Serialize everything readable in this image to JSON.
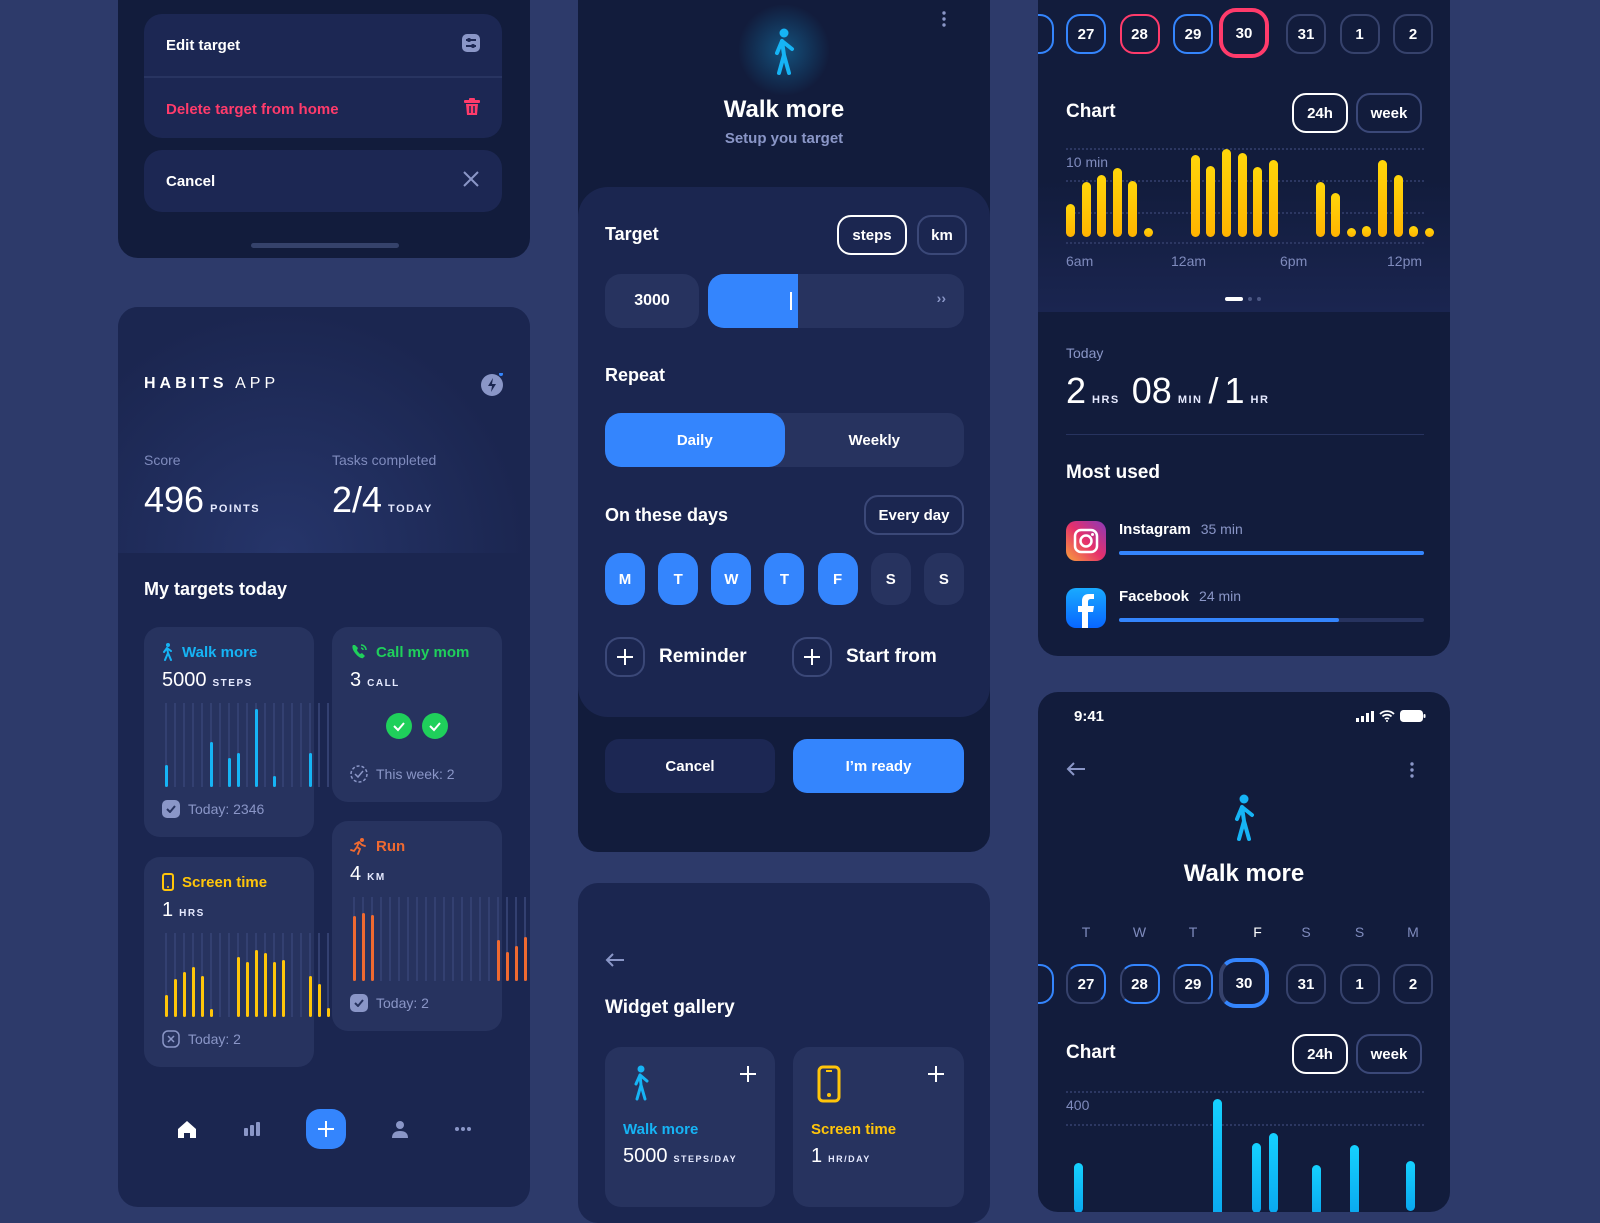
{
  "action_sheet": {
    "edit_label": "Edit target",
    "delete_label": "Delete target from home",
    "cancel_label": "Cancel"
  },
  "home": {
    "app_title_bold": "HABITS",
    "app_title_light": "APP",
    "score_label": "Score",
    "score_value": "496",
    "score_unit": "POINTS",
    "tasks_label": "Tasks completed",
    "tasks_value": "2/4",
    "tasks_unit": "TODAY",
    "section_title": "My targets today",
    "cards": {
      "walk": {
        "title": "Walk more",
        "value": "5000",
        "unit": "STEPS",
        "footer": "Today: 2346",
        "color": "#16b4f5",
        "bars": [
          0.26,
          0,
          0,
          0,
          0,
          0.53,
          0,
          0.34,
          0.4,
          0,
          0.93,
          0,
          0.13,
          0,
          0,
          0,
          0.4,
          0,
          0,
          0,
          0,
          0.2,
          0
        ]
      },
      "call": {
        "title": "Call my mom",
        "value": "3",
        "unit": "CALL",
        "footer": "This week: 2",
        "color": "#1fd05b",
        "done_count": 2
      },
      "screen": {
        "title": "Screen time",
        "value": "1",
        "unit": "HRS",
        "footer": "Today: 2",
        "color": "#ffc50a",
        "bars": [
          0.26,
          0.45,
          0.53,
          0.6,
          0.49,
          0.09,
          0,
          0,
          0.72,
          0.66,
          0.8,
          0.76,
          0.65,
          0.68,
          0,
          0,
          0.49,
          0.39,
          0.11,
          0.13,
          0.68,
          0.51,
          0.13,
          0.09
        ]
      },
      "run": {
        "title": "Run",
        "value": "4",
        "unit": "KM",
        "footer": "Today: 2",
        "color": "#f06a31",
        "bars": [
          0.77,
          0.81,
          0.78,
          0,
          0,
          0,
          0,
          0,
          0,
          0,
          0,
          0,
          0,
          0,
          0,
          0,
          0.49,
          0.35,
          0.42,
          0.52,
          0.4,
          0,
          0,
          0
        ]
      }
    },
    "nav": [
      "home",
      "stats",
      "add",
      "profile",
      "more"
    ]
  },
  "setup": {
    "title": "Walk more",
    "subtitle": "Setup you target",
    "target_label": "Target",
    "unit_options": [
      "steps",
      "km"
    ],
    "unit_selected": "steps",
    "target_value": "3000",
    "slider_fraction": 0.35,
    "repeat_label": "Repeat",
    "repeat_options": [
      "Daily",
      "Weekly"
    ],
    "repeat_selected": "Daily",
    "days_label": "On these days",
    "every_day_label": "Every day",
    "days": [
      {
        "label": "M",
        "on": true
      },
      {
        "label": "T",
        "on": true
      },
      {
        "label": "W",
        "on": true
      },
      {
        "label": "T",
        "on": true
      },
      {
        "label": "F",
        "on": true
      },
      {
        "label": "S",
        "on": false
      },
      {
        "label": "S",
        "on": false
      }
    ],
    "reminder_label": "Reminder",
    "start_from_label": "Start from",
    "cancel_label": "Cancel",
    "ready_label": "I’m ready"
  },
  "widget_gallery": {
    "title": "Widget gallery",
    "widgets": [
      {
        "title": "Walk more",
        "value": "5000",
        "unit": "STEPS/DAY",
        "color": "#16b4f5"
      },
      {
        "title": "Screen time",
        "value": "1",
        "unit": "HR/DAY",
        "color": "#ffc50a"
      }
    ]
  },
  "screen_time": {
    "dates": [
      "27",
      "28",
      "29",
      "30",
      "31",
      "1",
      "2"
    ],
    "chart_label": "Chart",
    "range_options": [
      "24h",
      "week"
    ],
    "range_selected": "24h",
    "y_label": "10 min",
    "x_labels": [
      "6am",
      "12am",
      "6pm",
      "12pm"
    ],
    "bars": [
      0.38,
      0.62,
      0.7,
      0.78,
      0.64,
      0.08,
      0,
      0,
      0.93,
      0.81,
      1.0,
      0.95,
      0.8,
      0.87,
      0,
      0,
      0.62,
      0.5,
      0.1,
      0.12,
      0.88,
      0.71,
      0.13,
      0.08
    ],
    "today_label": "Today",
    "today_hrs": "2",
    "hrs_unit": "HRS",
    "today_min": "08",
    "min_unit": "MIN",
    "goal": "1",
    "goal_unit": "HR",
    "most_used_label": "Most used",
    "apps": [
      {
        "name": "Instagram",
        "time": "35 min",
        "fraction": 1.0
      },
      {
        "name": "Facebook",
        "time": "24 min",
        "fraction": 0.72
      }
    ]
  },
  "detail": {
    "status_time": "9:41",
    "title": "Walk more",
    "weekdays": [
      "T",
      "W",
      "T",
      "F",
      "S",
      "S",
      "M"
    ],
    "dates": [
      "27",
      "28",
      "29",
      "30",
      "31",
      "1",
      "2"
    ],
    "chart_label": "Chart",
    "range_options": [
      "24h",
      "week"
    ],
    "y_label": "400"
  }
}
